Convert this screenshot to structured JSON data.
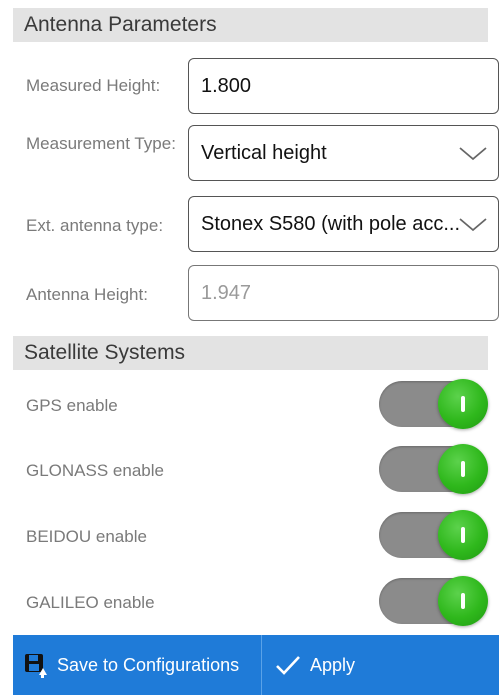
{
  "antenna": {
    "header": "Antenna Parameters",
    "measured_height": {
      "label": "Measured Height:",
      "value": "1.800"
    },
    "measurement_type": {
      "label": "Measurement Type:",
      "value": "Vertical height"
    },
    "ext_antenna_type": {
      "label": "Ext. antenna type:",
      "value": "Stonex S580 (with pole acc..."
    },
    "antenna_height": {
      "label": "Antenna Height:",
      "value": "1.947"
    }
  },
  "satellites": {
    "header": "Satellite Systems",
    "items": [
      {
        "label": "GPS enable",
        "enabled": true
      },
      {
        "label": "GLONASS enable",
        "enabled": true
      },
      {
        "label": "BEIDOU enable",
        "enabled": true
      },
      {
        "label": "GALILEO enable",
        "enabled": true
      }
    ]
  },
  "footer": {
    "save_label": "Save to Configurations",
    "apply_label": "Apply",
    "accent_color": "#1f7bd8"
  },
  "icons": {
    "save": "floppy-disk-upload-icon",
    "apply": "checkmark-icon",
    "dropdown": "chevron-down-icon",
    "toggle": "toggle-switch-on"
  }
}
